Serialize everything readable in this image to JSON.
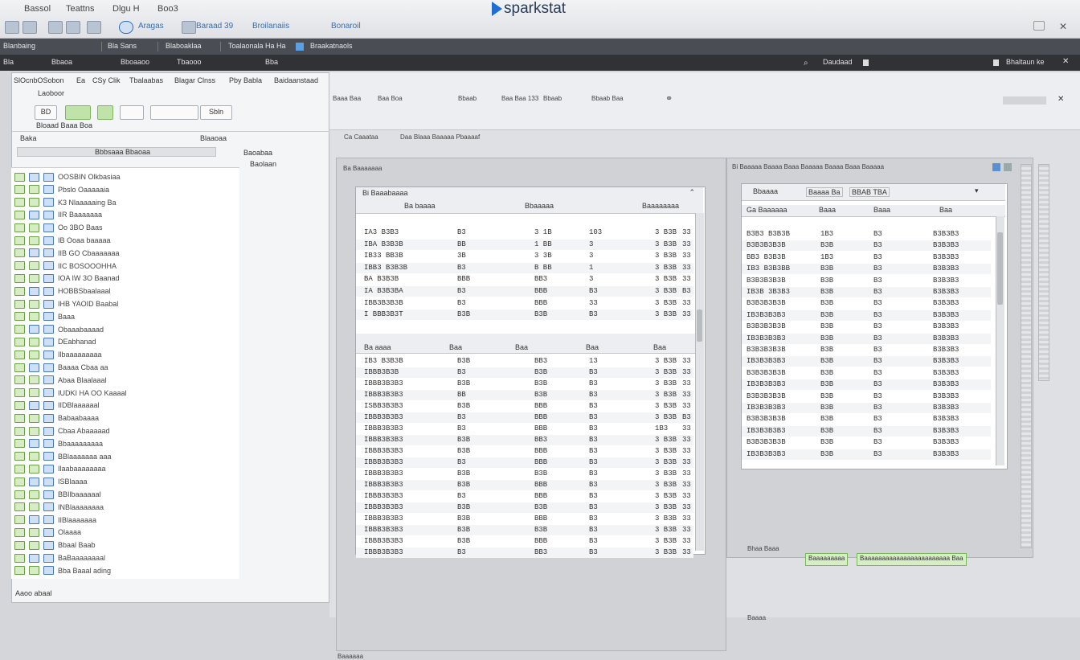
{
  "window": {
    "brand": "sparkstat",
    "menu": [
      "Bassol",
      "Teattns",
      "Dlgu H",
      "Boo3"
    ],
    "toolbar_links": [
      "Aragas",
      "Baraad 39",
      "Broilanaiis",
      "Bonaroil"
    ]
  },
  "bar1": {
    "tabs": [
      "Blanbaing",
      "Bla Sans",
      "Blaboaklaa",
      "Toalaonala Ha Ha",
      "Braakatnaols"
    ]
  },
  "bar2": {
    "tabs": [
      "Bla",
      "Bbaoa",
      "Bboaaoo",
      "Tbaooo",
      "Bba"
    ],
    "right": [
      "Daudaad",
      "Bhaltaun ke"
    ]
  },
  "leftpanel": {
    "tabs": [
      "SlOcnbOSobon",
      "Ea",
      "CSy Clik",
      "Tbalaabas",
      "Blagar Clnss",
      "Pby Babla",
      "Baidaanstaad"
    ],
    "subtitle": "Laoboor",
    "buttons": [
      "BD",
      "Sbln"
    ],
    "name_label": "Baka",
    "row2": "Bloaad Baaa Boa",
    "filter": "Blaaoaa",
    "tree_header": "Bbbsaaa Bbaoaa",
    "side_labels": [
      "Baoabaa",
      "Baolaan"
    ],
    "status": "Aaoo abaal",
    "tree_items": [
      "OOSBIN Olkbasiaa",
      "Pbslo Oaaaaaia",
      "K3 Nlaaaaaing Ba",
      "IIR Baaaaaaa",
      "Oo 3BO Baas",
      "IB Ooaa baaaaa",
      "IIB GO Cbaaaaaaa",
      "IIC BOSOOOHHA",
      "IOA IW 3O Baanad",
      "HOBBSbaalaaal",
      "IHB YAOID Baabal",
      "Baaa",
      "Obaaabaaaad",
      "DEabhanad",
      "Ilbaaaaaaaaa",
      "Baaaa Cbaa aa",
      "Abaa Blaalaaal",
      "IUDKI HA OO Kaaaal",
      "IIDBlaaaaaal",
      "Babaabaaaa",
      "Cbaa Abaaaaad",
      "Bbaaaaaaaaa",
      "BBlaaaaaaa aaa",
      "Ilaabaaaaaaaa",
      "ISBlaaaa",
      "BBIlbaaaaaal",
      "INBlaaaaaaaa",
      "IIBlaaaaaaa",
      "Olaaaa",
      "Bbaal Baab",
      "BaBaaaaaaaal",
      "Bba Baaal ading"
    ]
  },
  "content": {
    "toolbar_labels": [
      "Baaa Baa",
      "Baa Boa",
      "Bbaab",
      "Baa Baa 133",
      "Bbaab",
      "Bbaab Baa"
    ],
    "tab_row": [
      "Ca Caaataa",
      "Daa Blaaa Baaaaa Pbaaaaf"
    ],
    "left_panel_title": "Ba Baaaaaaa",
    "left_grid_title": "Bi Baaabaaaa",
    "left_grid_headers": [
      "Ba baaaa",
      "Bbaaaaa",
      "Baaaaaaaa"
    ],
    "left_grid_headers2": [
      "Ba aaaa",
      "Baa",
      "Baa",
      "Baa",
      "Baa"
    ],
    "left_rows": [
      [
        "IA3 B3B3",
        "B3",
        "3 1B",
        "103",
        "3 B3B",
        "33"
      ],
      [
        "IBA B3B3B",
        "BB",
        "1 BB",
        "3",
        "3 B3B",
        "33"
      ],
      [
        "IB33 BB3B",
        "3B",
        "3 3B",
        "3",
        "3 B3B",
        "33"
      ],
      [
        "IBB3 B3B3B",
        "B3",
        "B BB",
        "1",
        "3 B3B",
        "33"
      ],
      [
        "BA B3B3B",
        "BBB",
        "BB3",
        "3",
        "3 B3B",
        "33"
      ],
      [
        "IA B3B3BA",
        "B3",
        "BBB",
        "B3",
        "3 B3B",
        "B3"
      ],
      [
        "IBB3B3B3B",
        "B3",
        "BBB",
        "33",
        "3 B3B",
        "33"
      ],
      [
        "I BBB3B3T",
        "B3B",
        "B3B",
        "B3",
        "3 B3B",
        "33"
      ]
    ],
    "left_rows2": [
      [
        "IB3 B3B3B",
        "B3B",
        "BB3",
        "13",
        "3 B3B",
        "33"
      ],
      [
        "IBBB3B3B",
        "B3",
        "B3B",
        "B3",
        "3 B3B",
        "33"
      ],
      [
        "IBBB3B3B3",
        "B3B",
        "B3B",
        "B3",
        "3 B3B",
        "33"
      ],
      [
        "IBBB3B3B3",
        "BB",
        "B3B",
        "B3",
        "3 B3B",
        "33"
      ],
      [
        "ISBB3B3B3",
        "B3B",
        "BBB",
        "B3",
        "3 B3B",
        "33"
      ],
      [
        "IBBB3B3B3",
        "B3",
        "BBB",
        "B3",
        "3 B3B",
        "B3"
      ],
      [
        "IBBB3B3B3",
        "B3",
        "BBB",
        "B3",
        "1B3",
        "33"
      ],
      [
        "IBBB3B3B3",
        "B3B",
        "BB3",
        "B3",
        "3 B3B",
        "33"
      ],
      [
        "IBBB3B3B3",
        "B3B",
        "BBB",
        "B3",
        "3 B3B",
        "33"
      ],
      [
        "IBBB3B3B3",
        "B3",
        "BBB",
        "B3",
        "3 B3B",
        "33"
      ],
      [
        "IBBB3B3B3",
        "B3B",
        "B3B",
        "B3",
        "3 B3B",
        "33"
      ],
      [
        "IBBB3B3B3",
        "B3B",
        "BBB",
        "B3",
        "3 B3B",
        "33"
      ],
      [
        "IBBB3B3B3",
        "B3",
        "BBB",
        "B3",
        "3 B3B",
        "33"
      ],
      [
        "IBBB3B3B3",
        "B3B",
        "B3B",
        "B3",
        "3 B3B",
        "33"
      ],
      [
        "IBBB3B3B3",
        "B3B",
        "BBB",
        "B3",
        "3 B3B",
        "33"
      ],
      [
        "IBBB3B3B3",
        "B3B",
        "B3B",
        "B3",
        "3 B3B",
        "33"
      ],
      [
        "IBBB3B3B3",
        "B3B",
        "BBB",
        "B3",
        "3 B3B",
        "33"
      ],
      [
        "IBBB3B3B3",
        "B3",
        "BB3",
        "B3",
        "3 B3B",
        "33"
      ]
    ],
    "right_panel_title": "Bi Baaaaa Baaaa Baaa Baaaaa Baaaa Baaa Baaaaa",
    "right_grid_chips": [
      "Bbaaaa",
      "Baaaa Ba",
      "BBAB TBA"
    ],
    "right_grid_headers": [
      "Ga Baaaaaa",
      "Baaa",
      "Baaa",
      "Baa"
    ],
    "right_rows": [
      [
        "B3B3 B3B3B",
        "1B3",
        "B3",
        "B3B3B3"
      ],
      [
        "B3B3B3B3B",
        "B3B",
        "B3",
        "B3B3B3"
      ],
      [
        "BB3 B3B3B",
        "1B3",
        "B3",
        "B3B3B3"
      ],
      [
        "IB3 B3B3BB",
        "B3B",
        "B3",
        "B3B3B3"
      ],
      [
        "B3B3B3B3B",
        "B3B",
        "B3",
        "B3B3B3"
      ],
      [
        "IB3B 3B3B3",
        "B3B",
        "B3",
        "B3B3B3"
      ],
      [
        "B3B3B3B3B",
        "B3B",
        "B3",
        "B3B3B3"
      ],
      [
        "IB3B3B3B3",
        "B3B",
        "B3",
        "B3B3B3"
      ],
      [
        "B3B3B3B3B",
        "B3B",
        "B3",
        "B3B3B3"
      ],
      [
        "IB3B3B3B3",
        "B3B",
        "B3",
        "B3B3B3"
      ],
      [
        "B3B3B3B3B",
        "B3B",
        "B3",
        "B3B3B3"
      ],
      [
        "IB3B3B3B3",
        "B3B",
        "B3",
        "B3B3B3"
      ],
      [
        "B3B3B3B3B",
        "B3B",
        "B3",
        "B3B3B3"
      ],
      [
        "IB3B3B3B3",
        "B3B",
        "B3",
        "B3B3B3"
      ],
      [
        "B3B3B3B3B",
        "B3B",
        "B3",
        "B3B3B3"
      ],
      [
        "IB3B3B3B3",
        "B3B",
        "B3",
        "B3B3B3"
      ],
      [
        "B3B3B3B3B",
        "B3B",
        "B3",
        "B3B3B3"
      ],
      [
        "IB3B3B3B3",
        "B3B",
        "B3",
        "B3B3B3"
      ],
      [
        "B3B3B3B3B",
        "B3B",
        "B3",
        "B3B3B3"
      ],
      [
        "IB3B3B3B3",
        "B3B",
        "B3",
        "B3B3B3"
      ]
    ],
    "right_footer_label": "Bhaa Baaa",
    "right_green_chips": [
      "Baaaaaaaaa",
      "Baaaaaaaaaaaaaaaaaaaaaaaa Baa"
    ],
    "right_status": "Baaaa",
    "page_status": "Baaaaaa"
  }
}
